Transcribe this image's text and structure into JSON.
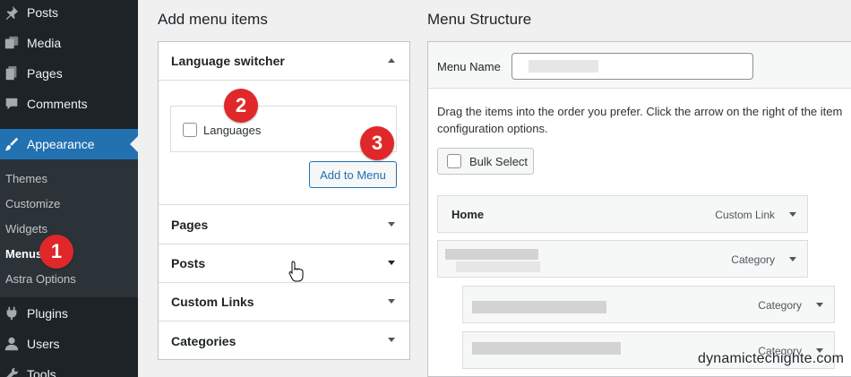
{
  "sidebar": {
    "items": [
      {
        "label": "Posts",
        "icon": "pin-icon"
      },
      {
        "label": "Media",
        "icon": "media-icon"
      },
      {
        "label": "Pages",
        "icon": "pages-icon"
      },
      {
        "label": "Comments",
        "icon": "comment-icon"
      },
      {
        "label": "Appearance",
        "icon": "brush-icon"
      },
      {
        "label": "Plugins",
        "icon": "plug-icon"
      },
      {
        "label": "Users",
        "icon": "user-icon"
      },
      {
        "label": "Tools",
        "icon": "wrench-icon"
      }
    ],
    "appearance_submenu": [
      "Themes",
      "Customize",
      "Widgets",
      "Menus",
      "Astra Options"
    ],
    "current_submenu": "Menus"
  },
  "badges": [
    "1",
    "2",
    "3"
  ],
  "add_items": {
    "title": "Add menu items",
    "sections": [
      "Language switcher",
      "Pages",
      "Posts",
      "Custom Links",
      "Categories"
    ],
    "language_checkbox_label": "Languages",
    "add_button": "Add to Menu"
  },
  "structure": {
    "title": "Menu Structure",
    "menu_name_label": "Menu Name",
    "instructions_line1": "Drag the items into the order you prefer. Click the arrow on the right of the item",
    "instructions_line2": "configuration options.",
    "bulk_select": "Bulk Select",
    "items": [
      {
        "title": "Home",
        "type": "Custom Link"
      },
      {
        "title": "",
        "type": "Category"
      },
      {
        "title": "",
        "type": "Category"
      },
      {
        "title": "",
        "type": "Category"
      }
    ]
  },
  "watermark": "dynamictechighte.com",
  "colors": {
    "sidebar": "#1d2327",
    "accent": "#2271b1",
    "badge": "#e0282a"
  }
}
